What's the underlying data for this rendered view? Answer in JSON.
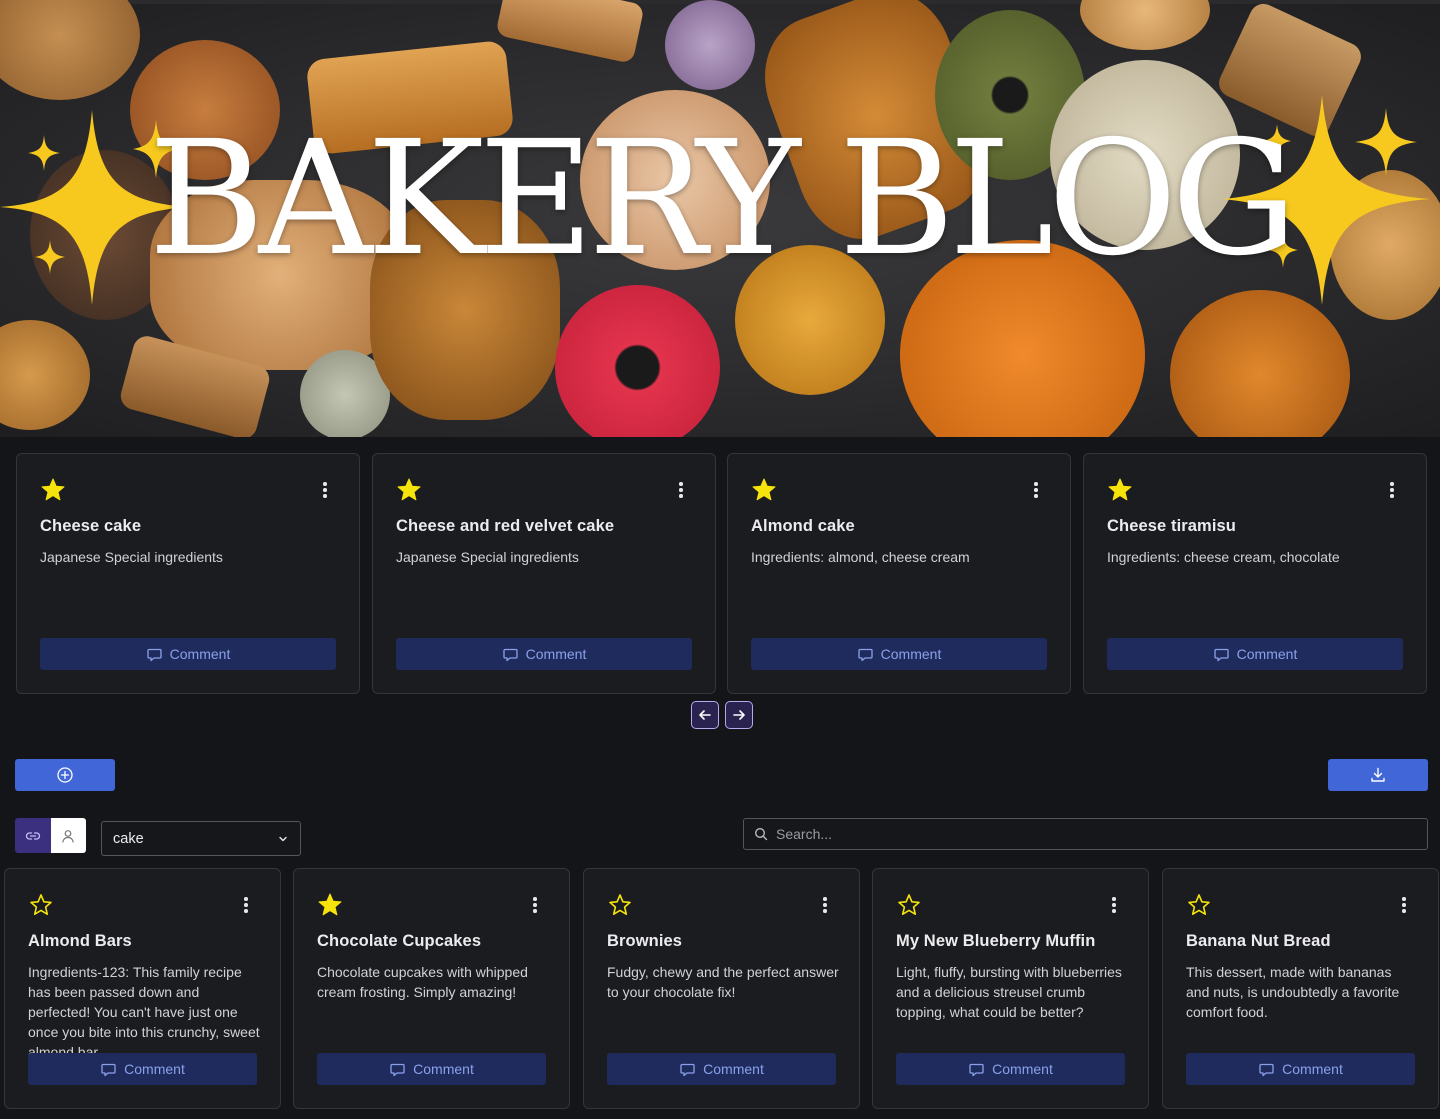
{
  "hero": {
    "title": "BAKERY BLOG"
  },
  "colors": {
    "accent": "#4066d8",
    "comment_bg": "#1f2b5c",
    "comment_text": "#8aa0ea",
    "star": "#f5e30b",
    "card_bg": "#1b1c20"
  },
  "featured": {
    "cards": [
      {
        "title": "Cheese cake",
        "description": "Japanese Special ingredients",
        "starred": true,
        "comment_label": "Comment"
      },
      {
        "title": "Cheese and red velvet cake",
        "description": "Japanese Special ingredients",
        "starred": true,
        "comment_label": "Comment"
      },
      {
        "title": "Almond cake",
        "description": "Ingredients: almond, cheese cream",
        "starred": true,
        "comment_label": "Comment"
      },
      {
        "title": "Cheese tiramisu",
        "description": "Ingredients: cheese cream, chocolate",
        "starred": true,
        "comment_label": "Comment"
      }
    ],
    "prev_icon": "arrow-left-icon",
    "next_icon": "arrow-right-icon"
  },
  "toolbar": {
    "add_icon": "plus-circle-icon",
    "download_icon": "download-icon",
    "view_toggle": {
      "options": [
        "link-icon",
        "user-icon"
      ],
      "selected": "link-icon"
    },
    "filter": {
      "selected": "cake"
    },
    "search": {
      "placeholder": "Search...",
      "value": ""
    }
  },
  "posts": {
    "cards": [
      {
        "title": "Almond Bars",
        "description": "Ingredients-123: This family recipe has been passed down and perfected! You can't have just one once you bite into this crunchy, sweet almond bar.",
        "starred": false,
        "comment_label": "Comment"
      },
      {
        "title": "Chocolate Cupcakes",
        "description": "Chocolate cupcakes with whipped cream frosting. Simply amazing!",
        "starred": true,
        "comment_label": "Comment"
      },
      {
        "title": "Brownies",
        "description": "Fudgy, chewy and the perfect answer to your chocolate fix!",
        "starred": false,
        "comment_label": "Comment"
      },
      {
        "title": "My New Blueberry Muffin",
        "description": "Light, fluffy, bursting with blueberries and a delicious streusel crumb topping, what could be better?",
        "starred": false,
        "comment_label": "Comment"
      },
      {
        "title": "Banana Nut Bread",
        "description": "This dessert, made with bananas and nuts, is undoubtedly a favorite comfort food.",
        "starred": false,
        "comment_label": "Comment"
      }
    ]
  }
}
